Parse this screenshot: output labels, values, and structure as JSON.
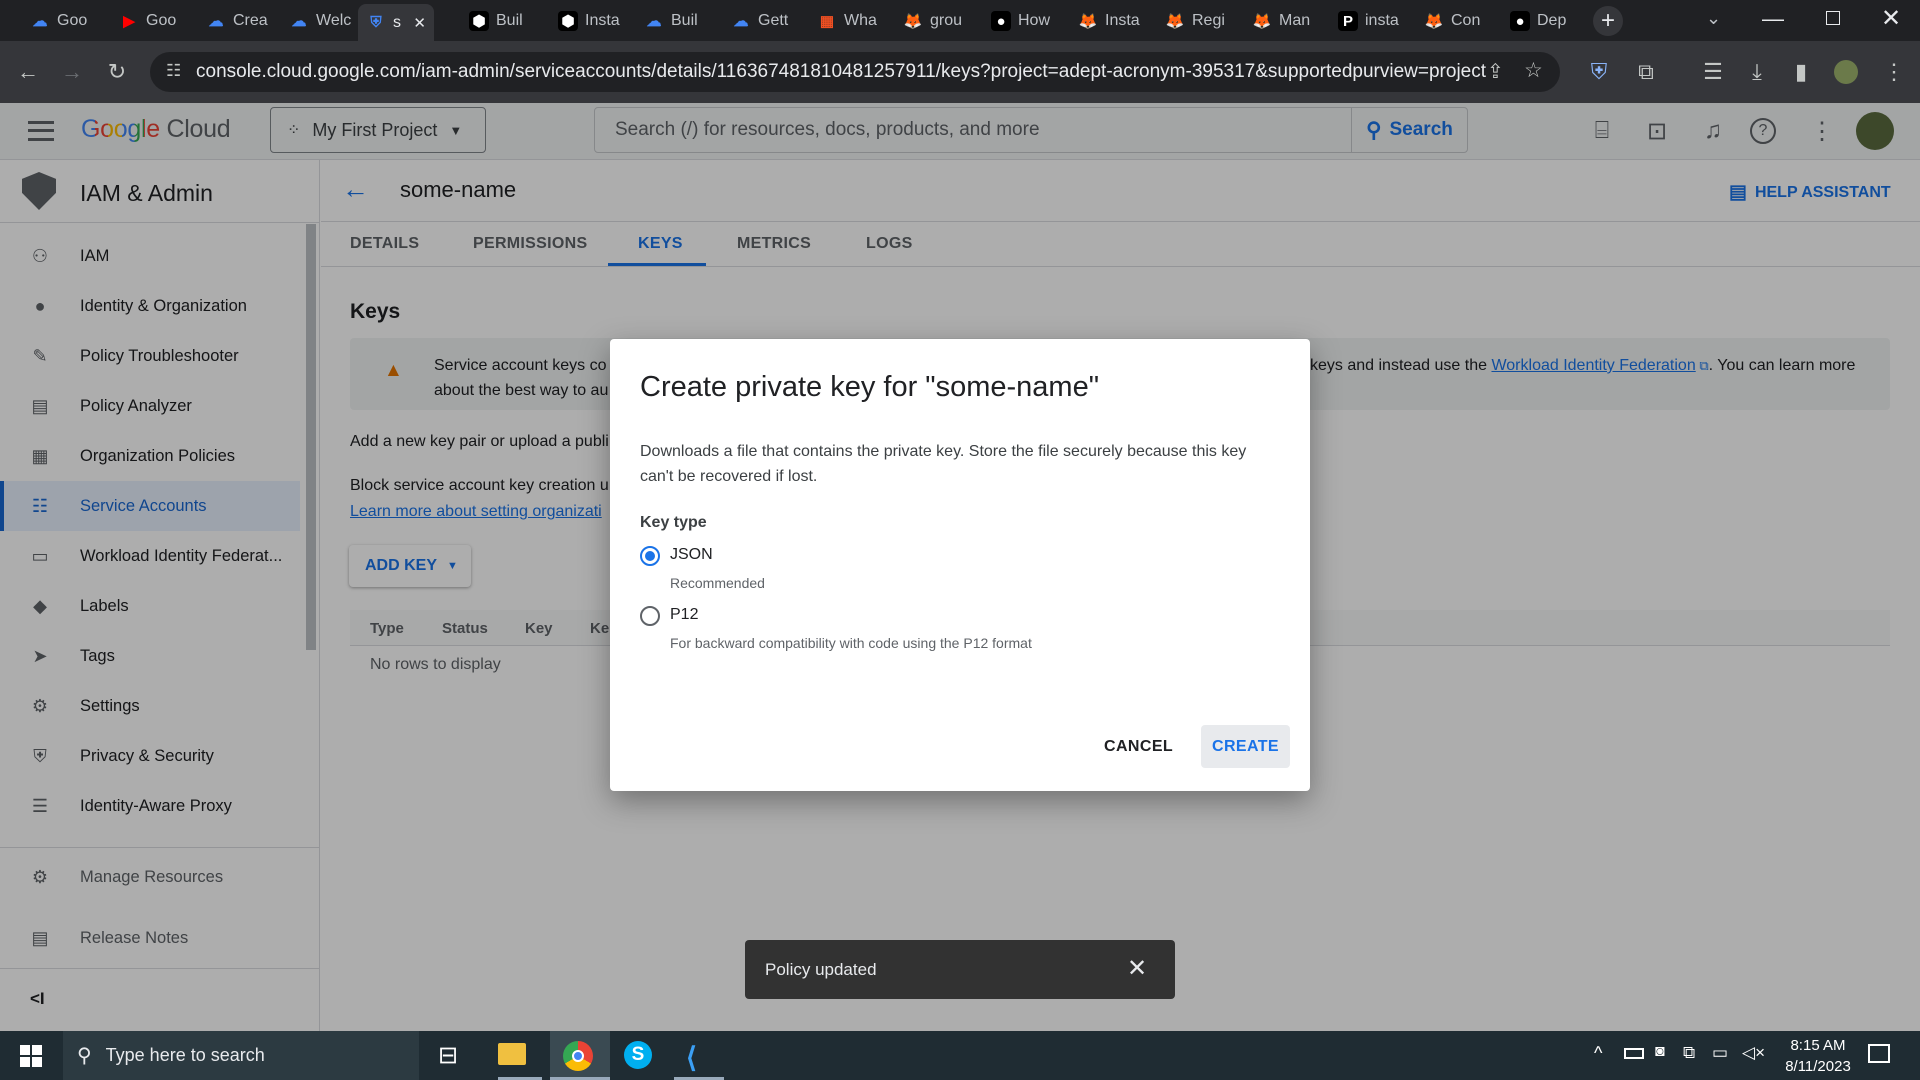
{
  "browser": {
    "tabs": [
      {
        "label": "Goo",
        "icon": "google-cloud-icon",
        "color": "#4285f4"
      },
      {
        "label": "Goo",
        "icon": "youtube-icon",
        "color": "#ff0000"
      },
      {
        "label": "Crea",
        "icon": "google-cloud-icon",
        "color": "#4285f4"
      },
      {
        "label": "Welc",
        "icon": "google-cloud-icon",
        "color": "#4285f4"
      },
      {
        "label": "s",
        "icon": "shield-icon",
        "color": "#4285f4",
        "active": true
      },
      {
        "label": "Buil",
        "icon": "hashicorp-icon",
        "color": "#ffffff"
      },
      {
        "label": "Insta",
        "icon": "hashicorp-icon",
        "color": "#ffffff"
      },
      {
        "label": "Buil",
        "icon": "google-cloud-icon",
        "color": "#4285f4"
      },
      {
        "label": "Gett",
        "icon": "google-cloud-icon",
        "color": "#4285f4"
      },
      {
        "label": "Wha",
        "icon": "microsoft-icon",
        "color": "#f25022"
      },
      {
        "label": "grou",
        "icon": "gitlab-icon",
        "color": "#fc6d26"
      },
      {
        "label": "How",
        "icon": "medium-icon",
        "color": "#ffffff"
      },
      {
        "label": "Insta",
        "icon": "gitlab-icon",
        "color": "#fc6d26"
      },
      {
        "label": "Regi",
        "icon": "gitlab-icon",
        "color": "#fc6d26"
      },
      {
        "label": "Man",
        "icon": "gitlab-icon",
        "color": "#fc6d26"
      },
      {
        "label": "insta",
        "icon": "p-icon",
        "color": "#ffffff"
      },
      {
        "label": "Con",
        "icon": "gitlab-icon",
        "color": "#fc6d26"
      },
      {
        "label": "Dep",
        "icon": "medium-icon",
        "color": "#ffffff"
      }
    ],
    "url": "console.cloud.google.com/iam-admin/serviceaccounts/details/116367481810481257911/keys?project=adept-acronym-395317&supportedpurview=project"
  },
  "gcp": {
    "logo_google": "Google",
    "logo_cloud": "Cloud",
    "project": "My First Project",
    "search_placeholder": "Search (/) for resources, docs, products, and more",
    "search_button": "Search"
  },
  "sidebar": {
    "title": "IAM & Admin",
    "items": [
      {
        "label": "IAM",
        "icon": "person-add-icon"
      },
      {
        "label": "Identity & Organization",
        "icon": "account-circle-icon"
      },
      {
        "label": "Policy Troubleshooter",
        "icon": "wrench-icon"
      },
      {
        "label": "Policy Analyzer",
        "icon": "document-search-icon"
      },
      {
        "label": "Organization Policies",
        "icon": "list-document-icon"
      },
      {
        "label": "Service Accounts",
        "icon": "service-account-icon",
        "selected": true
      },
      {
        "label": "Workload Identity Federat...",
        "icon": "id-card-icon"
      },
      {
        "label": "Labels",
        "icon": "label-icon"
      },
      {
        "label": "Tags",
        "icon": "tag-icon"
      },
      {
        "label": "Settings",
        "icon": "gear-icon"
      },
      {
        "label": "Privacy & Security",
        "icon": "shield-icon"
      },
      {
        "label": "Identity-Aware Proxy",
        "icon": "proxy-icon"
      }
    ],
    "footer_items": [
      {
        "label": "Manage Resources",
        "icon": "folder-gear-icon"
      },
      {
        "label": "Release Notes",
        "icon": "notes-icon"
      }
    ]
  },
  "page": {
    "title": "some-name",
    "help": "HELP ASSISTANT",
    "tabs": [
      "DETAILS",
      "PERMISSIONS",
      "KEYS",
      "METRICS",
      "LOGS"
    ],
    "active_tab": "KEYS",
    "section_title": "Keys",
    "warning_text_left1": "Service account keys co",
    "warning_text_left2": "about the best way to au",
    "warning_text_right1": "keys and instead use the",
    "warning_link": "Workload Identity Federation",
    "warning_text_right2": ". You can learn more",
    "add_key_text": "Add a new key pair or upload a publi",
    "block_text": "Block service account key creation u",
    "learn_more": "Learn more about setting organizati",
    "add_key_button": "ADD KEY",
    "table_headers": [
      "Type",
      "Status",
      "Key",
      "Ke"
    ],
    "empty": "No rows to display"
  },
  "dialog": {
    "title": "Create private key for \"some-name\"",
    "description": "Downloads a file that contains the private key. Store the file securely because this key can't be recovered if lost.",
    "key_type_label": "Key type",
    "options": [
      {
        "label": "JSON",
        "hint": "Recommended",
        "checked": true
      },
      {
        "label": "P12",
        "hint": "For backward compatibility with code using the P12 format",
        "checked": false
      }
    ],
    "cancel": "CANCEL",
    "create": "CREATE"
  },
  "snackbar": {
    "message": "Policy updated"
  },
  "taskbar": {
    "search_placeholder": "Type here to search",
    "time": "8:15 AM",
    "date": "8/11/2023"
  }
}
